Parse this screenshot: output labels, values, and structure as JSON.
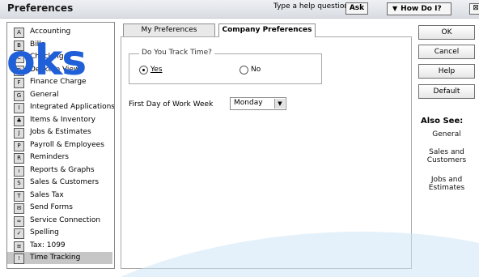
{
  "window": {
    "title": "Preferences",
    "help_question": "Type a help question",
    "ask": "Ask",
    "how_do_i": "How Do I?",
    "close_glyph": "⊠"
  },
  "overlay": {
    "logo_text": "oks"
  },
  "sidebar": {
    "items": [
      {
        "label": "Accounting",
        "icon": "accounting-icon",
        "glyph": "A"
      },
      {
        "label": "Bills",
        "icon": "bills-icon",
        "glyph": "B"
      },
      {
        "label": "Checking",
        "icon": "checking-icon",
        "glyph": "C"
      },
      {
        "label": "Desktop View",
        "icon": "desktop-view-icon",
        "glyph": "D"
      },
      {
        "label": "Finance Charge",
        "icon": "finance-charge-icon",
        "glyph": "F"
      },
      {
        "label": "General",
        "icon": "general-icon",
        "glyph": "G"
      },
      {
        "label": "Integrated Applications",
        "icon": "integrated-apps-icon",
        "glyph": "I"
      },
      {
        "label": "Items & Inventory",
        "icon": "items-inventory-icon",
        "glyph": "♣"
      },
      {
        "label": "Jobs & Estimates",
        "icon": "jobs-estimates-icon",
        "glyph": "J"
      },
      {
        "label": "Payroll & Employees",
        "icon": "payroll-icon",
        "glyph": "P"
      },
      {
        "label": "Reminders",
        "icon": "reminders-icon",
        "glyph": "R"
      },
      {
        "label": "Reports & Graphs",
        "icon": "reports-graphs-icon",
        "glyph": "ı"
      },
      {
        "label": "Sales & Customers",
        "icon": "sales-customers-icon",
        "glyph": "S"
      },
      {
        "label": "Sales Tax",
        "icon": "sales-tax-icon",
        "glyph": "T"
      },
      {
        "label": "Send Forms",
        "icon": "send-forms-icon",
        "glyph": "✉"
      },
      {
        "label": "Service Connection",
        "icon": "service-connection-icon",
        "glyph": "∞"
      },
      {
        "label": "Spelling",
        "icon": "spelling-icon",
        "glyph": "✓"
      },
      {
        "label": "Tax: 1099",
        "icon": "tax-1099-icon",
        "glyph": "≡"
      },
      {
        "label": "Time Tracking",
        "icon": "time-tracking-icon",
        "glyph": "!"
      }
    ],
    "selected_index": 18
  },
  "tabs": [
    {
      "label": "My Preferences",
      "active": false
    },
    {
      "label": "Company Preferences",
      "active": true
    }
  ],
  "company": {
    "track_time_legend": "Do You Track Time?",
    "yes_label": "Yes",
    "no_label": "No",
    "selected": "Yes",
    "first_day_label": "First Day of Work Week",
    "first_day_value": "Monday"
  },
  "buttons": {
    "ok": "OK",
    "cancel": "Cancel",
    "help": "Help",
    "default": "Default"
  },
  "also_see": {
    "title": "Also See:",
    "links": [
      "General",
      "Sales and Customers",
      "Jobs and Estimates"
    ]
  },
  "colors": {
    "accent": "#1f5fd8",
    "swoosh": "#cde6f5",
    "selected_row": "#c6c6c6"
  }
}
